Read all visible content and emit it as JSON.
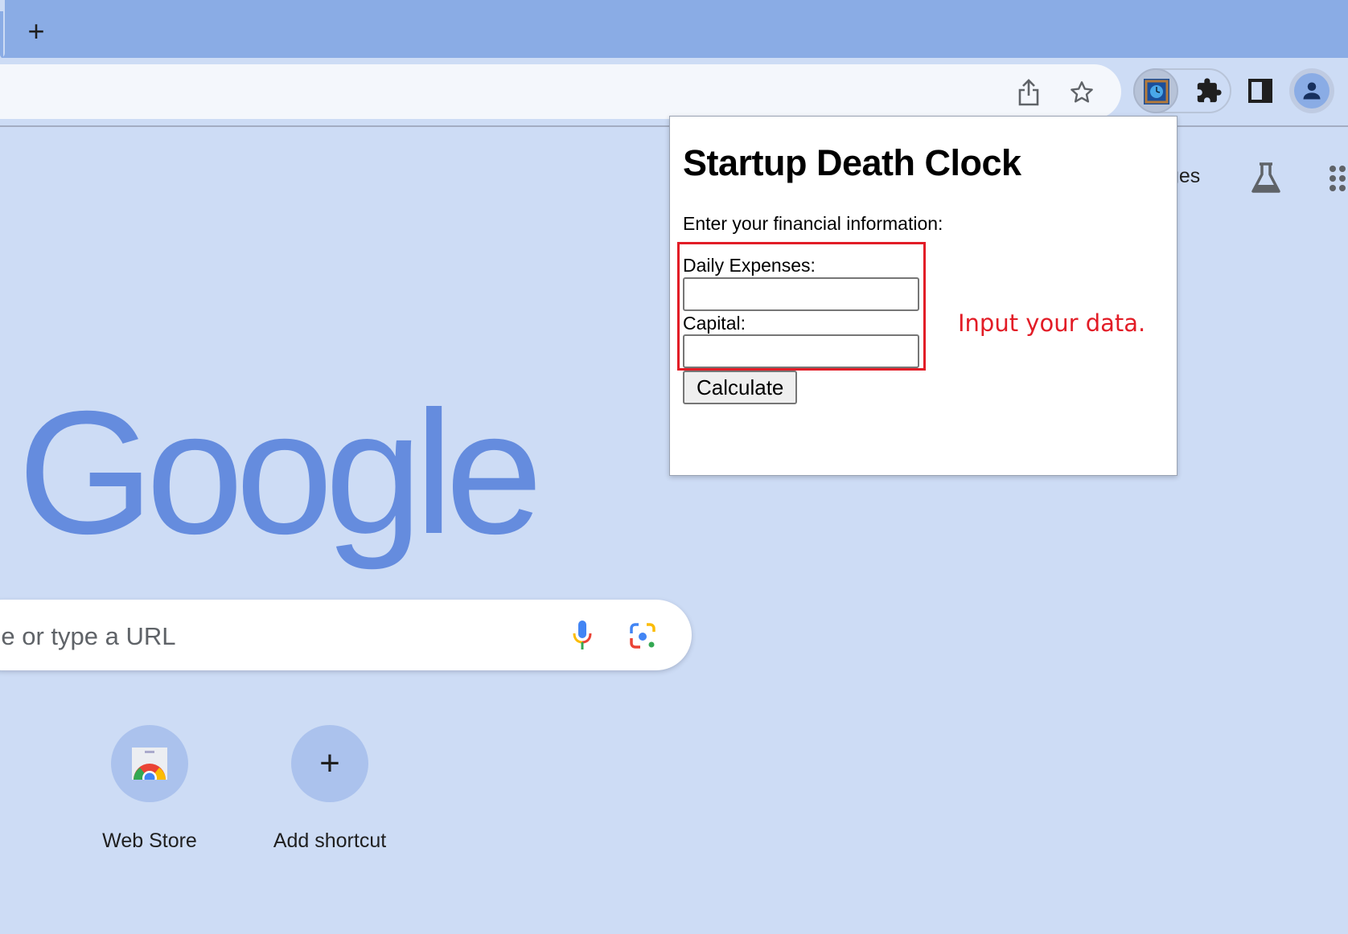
{
  "browser": {
    "new_tab_label": "+",
    "toolbar_icons": [
      "share-icon",
      "bookmark-star-icon",
      "death-clock-extension-icon",
      "extensions-puzzle-icon",
      "side-panel-icon",
      "profile-avatar-icon"
    ]
  },
  "ntp": {
    "top_link_partial": "ges",
    "logo_text": "Google",
    "search_placeholder": "ogle or type a URL",
    "shortcuts": [
      {
        "label": "Web Store",
        "icon": "web-store-icon"
      },
      {
        "label": "Add shortcut",
        "icon": "plus-icon",
        "glyph": "+"
      }
    ]
  },
  "popup": {
    "title": "Startup Death Clock",
    "subtitle": "Enter your financial information:",
    "fields": [
      {
        "label": "Daily Expenses:",
        "value": ""
      },
      {
        "label": "Capital:",
        "value": ""
      }
    ],
    "button_label": "Calculate"
  },
  "annotation": {
    "text": "Input your data.",
    "color": "#e21c26"
  }
}
